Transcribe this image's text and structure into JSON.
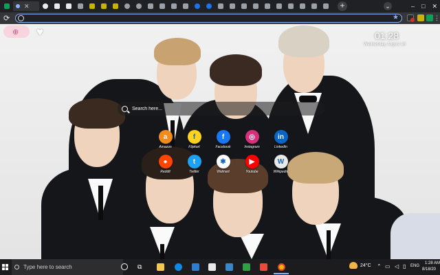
{
  "browser": {
    "address_value": "",
    "close_label": "✕",
    "new_tab_label": "+",
    "window_controls": [
      "–",
      "□",
      "✕"
    ]
  },
  "newtab": {
    "clock_time": "01:28",
    "clock_sub": "Wednesday, August 18",
    "search_placeholder": "Search here...",
    "shortcuts": [
      {
        "label": "Amazon",
        "icon": "amazon-icon",
        "glyph": "a",
        "color": "#f08b1c"
      },
      {
        "label": "Flipkart",
        "icon": "flipkart-icon",
        "glyph": "f",
        "color": "#ffd21e"
      },
      {
        "label": "Facebook",
        "icon": "facebook-icon",
        "glyph": "f",
        "color": "#1877f2"
      },
      {
        "label": "Instagram",
        "icon": "instagram-icon",
        "glyph": "◎",
        "color": "#d6307d"
      },
      {
        "label": "LinkedIn",
        "icon": "linkedin-icon",
        "glyph": "in",
        "color": "#0a66c2"
      },
      {
        "label": "Reddit",
        "icon": "reddit-icon",
        "glyph": "●",
        "color": "#ff4500"
      },
      {
        "label": "Twitter",
        "icon": "twitter-icon",
        "glyph": "t",
        "color": "#1da1f2"
      },
      {
        "label": "Walmart",
        "icon": "walmart-icon",
        "glyph": "✱",
        "color": "#ffffff"
      },
      {
        "label": "Youtube",
        "icon": "youtube-icon",
        "glyph": "▶",
        "color": "#ff0000"
      },
      {
        "label": "Wikipedia",
        "icon": "wikipedia-icon",
        "glyph": "W",
        "color": "#e8e8e8"
      }
    ]
  },
  "taskbar": {
    "search_text": "Type here to search",
    "temperature": "24°C",
    "language": "ENG",
    "time": "1:28 AM",
    "date": "8/18/20"
  }
}
